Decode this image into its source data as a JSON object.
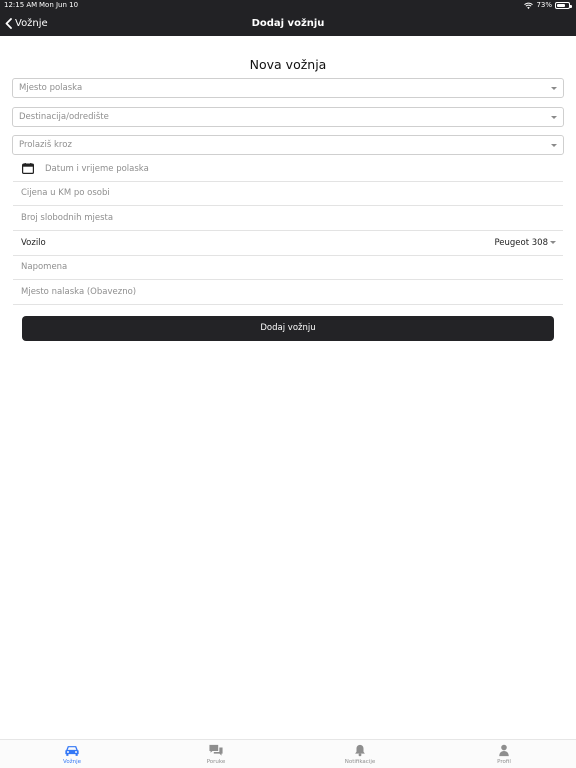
{
  "status_bar": {
    "time": "12:15 AM",
    "date": "Mon Jun 10",
    "battery": "73%",
    "battery_level": 0.73
  },
  "nav": {
    "back_label": "Vožnje",
    "title": "Dodaj vožnju"
  },
  "form": {
    "title": "Nova vožnja",
    "departure_placeholder": "Mjesto polaska",
    "destination_placeholder": "Destinacija/odredište",
    "via_placeholder": "Prolaziš kroz",
    "datetime_placeholder": "Datum i vrijeme polaska",
    "price_placeholder": "Cijena u KM po osobi",
    "seats_placeholder": "Broj slobodnih mjesta",
    "vehicle_label": "Vozilo",
    "vehicle_value": "Peugeot 308",
    "note_placeholder": "Napomena",
    "meeting_point_placeholder": "Mjesto nalaska (Obavezno)",
    "submit_label": "Dodaj vožnju"
  },
  "tabs": [
    {
      "label": "Vožnje",
      "icon": "car-icon",
      "active": true
    },
    {
      "label": "Poruke",
      "icon": "chat-bubbles-icon",
      "active": false
    },
    {
      "label": "Notifikacije",
      "icon": "bell-icon",
      "active": false
    },
    {
      "label": "Profil",
      "icon": "person-icon",
      "active": false
    }
  ],
  "colors": {
    "header": "#222225",
    "accent": "#3478f6",
    "button": "#232326"
  }
}
